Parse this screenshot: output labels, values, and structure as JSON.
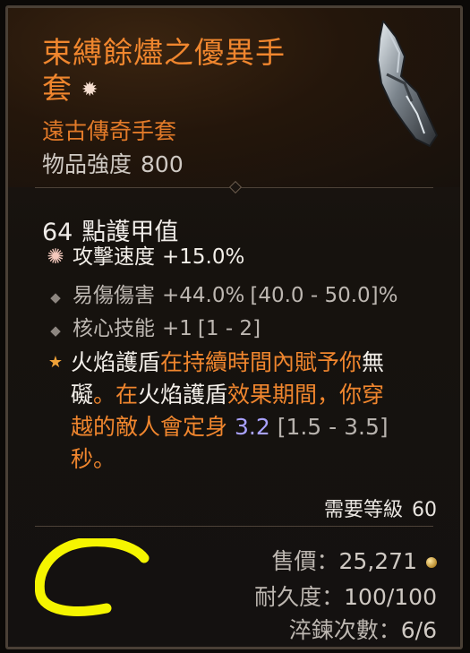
{
  "item": {
    "name_line1": "束縛餘燼之優異手",
    "name_line2": "套",
    "name_badge_icon": "mastery-star-icon",
    "rarity": "遠古傳奇手套",
    "power_label": "物品強度",
    "power_value": "800",
    "armor_value": "64",
    "armor_label": "點護甲值"
  },
  "affixes": [
    {
      "icon": "pink-star-bullet-icon",
      "name": "攻擊速度",
      "value": "+15.0%",
      "range": ""
    },
    {
      "icon": "diamond-bullet-icon",
      "name": "易傷傷害",
      "value": "+44.0%",
      "range": "[40.0 - 50.0]%"
    },
    {
      "icon": "diamond-bullet-icon",
      "name": "核心技能",
      "value": "+1",
      "range": "[1 - 2]"
    }
  ],
  "aspect": {
    "icon": "legendary-star-icon",
    "seg1": "火焰護盾",
    "seg2": "在持續時間內賦予你",
    "seg3": "無",
    "seg4": "礙",
    "seg5": "。在",
    "seg6": "火焰護盾",
    "seg7": "效果期間，你穿",
    "seg8": "越的敵人會定身",
    "seg9": "3.2",
    "seg10": "[1.5 - 3.5]",
    "seg11": "秒。"
  },
  "requirement": {
    "label": "需要等級",
    "value": "60"
  },
  "meta": {
    "price_label": "售價：",
    "price_value": "25,271",
    "price_icon": "gold-coin-icon",
    "durability_label": "耐久度：",
    "durability_value": "100/100",
    "temper_label": "淬鍊次數：",
    "temper_value": "6/6"
  },
  "colors": {
    "legendary_orange": "#f0862e",
    "aspect_gold": "#f0a238",
    "value_purple": "#a9a2ff",
    "annotation_yellow": "#f5f500"
  }
}
